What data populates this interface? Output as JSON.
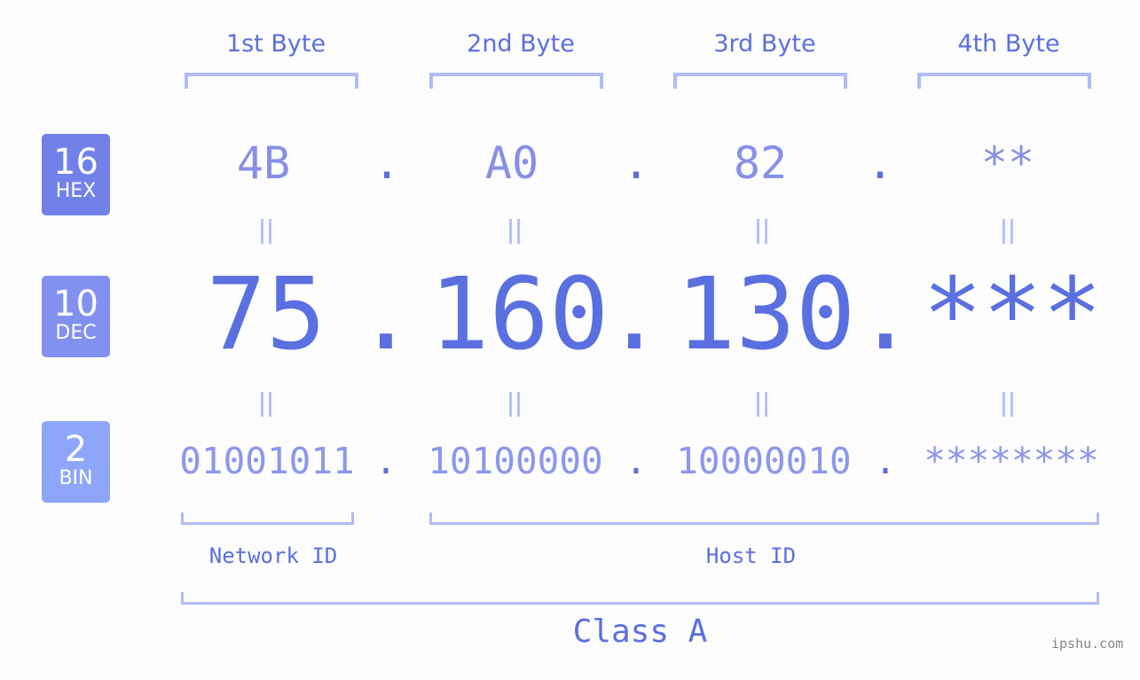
{
  "bytes": [
    {
      "label": "1st Byte",
      "hex": "4B",
      "dec": "75",
      "bin": "01001011"
    },
    {
      "label": "2nd Byte",
      "hex": "A0",
      "dec": "160",
      "bin": "10100000"
    },
    {
      "label": "3rd Byte",
      "hex": "82",
      "dec": "130",
      "bin": "10000010"
    },
    {
      "label": "4th Byte",
      "hex": "**",
      "dec": "***",
      "bin": "********"
    }
  ],
  "separator": ".",
  "badges": {
    "hex": {
      "num": "16",
      "label": "HEX",
      "color": "#7280ea"
    },
    "dec": {
      "num": "10",
      "label": "DEC",
      "color": "#8291f0"
    },
    "bin": {
      "num": "2",
      "label": "BIN",
      "color": "#8ea6fa"
    }
  },
  "network_id_label": "Network ID",
  "host_id_label": "Host ID",
  "class_label": "Class A",
  "watermark": "ipshu.com",
  "colors": {
    "primary": "#5a6fe0",
    "bracket": "#b0bbf7",
    "background": "#fcfdfc"
  }
}
